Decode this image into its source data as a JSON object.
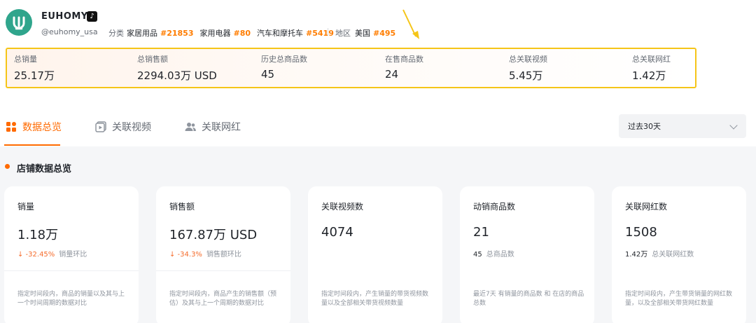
{
  "shop": {
    "name": "EUHOMY",
    "handle": "@euhomy_usa",
    "category_label": "分类",
    "categories": [
      {
        "name": "家居用品",
        "rank": "#21853"
      },
      {
        "name": "家用电器",
        "rank": "#80"
      },
      {
        "name": "汽车和摩托车",
        "rank": "#5419"
      }
    ],
    "region_label": "地区",
    "region": {
      "name": "美国",
      "rank": "#495"
    }
  },
  "stats": [
    {
      "label": "总销量",
      "value": "25.17万"
    },
    {
      "label": "总销售额",
      "value": "2294.03万 USD"
    },
    {
      "label": "历史总商品数",
      "value": "45"
    },
    {
      "label": "在售商品数",
      "value": "24"
    },
    {
      "label": "总关联视频",
      "value": "5.45万"
    },
    {
      "label": "总关联网红",
      "value": "1.42万"
    }
  ],
  "tabs": [
    {
      "label": "数据总览",
      "icon": "grid-icon",
      "active": true
    },
    {
      "label": "关联视频",
      "icon": "video-icon",
      "active": false
    },
    {
      "label": "关联网红",
      "icon": "users-icon",
      "active": false
    }
  ],
  "range": {
    "selected": "过去30天"
  },
  "section": {
    "title": "店铺数据总览"
  },
  "cards": [
    {
      "label": "销量",
      "value": "1.18万",
      "change": "↓ -32.45%",
      "change_label": "销量环比",
      "desc": "指定时间段内，商品的销量以及其与上一个时间周期的数据对比"
    },
    {
      "label": "销售额",
      "value": "167.87万 USD",
      "change": "↓ -34.3%",
      "change_label": "销售额环比",
      "desc": "指定时间段内，商品产生的销售额（预估）及其与上一个周期的数据对比"
    },
    {
      "label": "关联视频数",
      "value": "4074",
      "desc": "指定时间段内，产生销量的带货视频数量以及全部相关带货视频数量"
    },
    {
      "label": "动销商品数",
      "value": "21",
      "sub_num": "45",
      "sub_label": "总商品数",
      "desc": "最近7天 有销量的商品数 和 在店的商品总数"
    },
    {
      "label": "关联网红数",
      "value": "1508",
      "sub_num": "1.42万",
      "sub_label": "总关联网红数",
      "desc": "指定时间段内，产生带货销量的网红数量，以及全部相关带货网红数量"
    }
  ],
  "colors": {
    "accent": "#ff6a00",
    "highlight_border": "#f5c518",
    "rank": "#ff7d00",
    "logo": "#2fa58c"
  }
}
